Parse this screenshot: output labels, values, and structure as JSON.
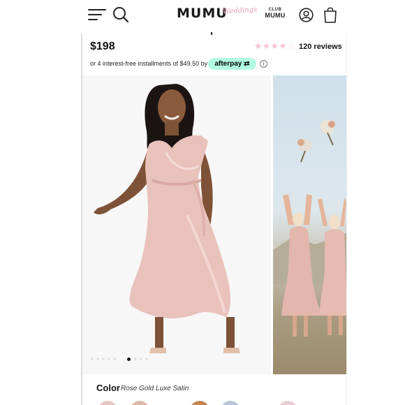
{
  "header": {
    "logo_main": "MUMU",
    "logo_script": "Weddings",
    "club_small": "CLUB",
    "club_big": "MUMU",
    "icons": [
      "menu-icon",
      "search-icon",
      "account-icon",
      "cart-icon"
    ]
  },
  "product": {
    "price": "$198",
    "rating": {
      "value": 4,
      "max": 5,
      "reviews_label": "120 reviews"
    },
    "installments_text": "or 4 interest-free installments of $49.50 by",
    "afterpay_label": "afterpay",
    "afterpay_arrows": "⇄",
    "info_icon": "i"
  },
  "gallery": {
    "image_count": 9,
    "active_index": 5
  },
  "color": {
    "label": "Color",
    "value": "Rose Gold Luxe Satin",
    "swatches": [
      "#e6c7c2",
      "#d9b9a7",
      "#c08552",
      "#b7c5d4",
      "#e8cfd6"
    ]
  },
  "colors": {
    "accent_afterpay": "#b2fce4",
    "dress": "#e9c2bc",
    "star": "#f2c7cf"
  }
}
